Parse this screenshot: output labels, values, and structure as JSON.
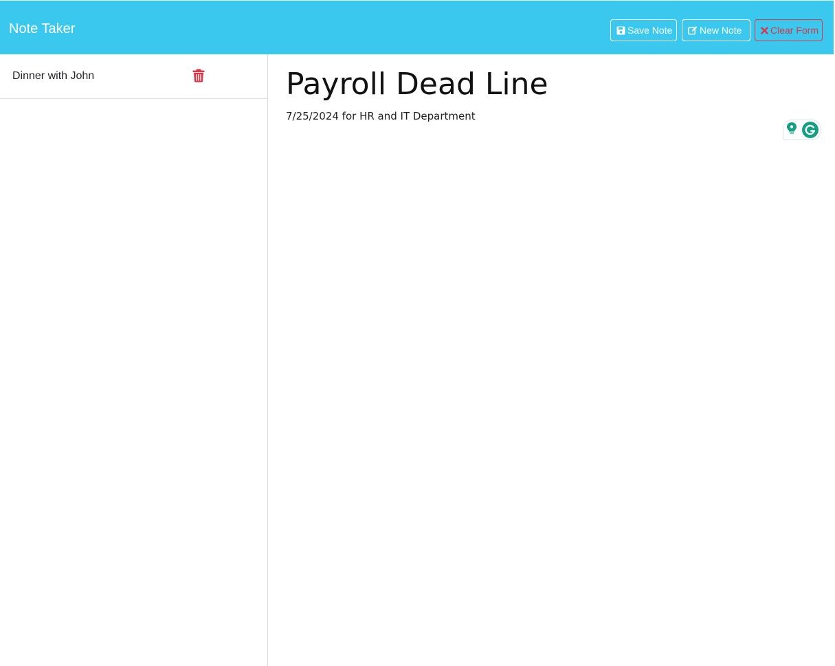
{
  "navbar": {
    "title": "Note Taker",
    "buttons": {
      "save": "Save Note",
      "new": "New Note",
      "clear": "Clear Form"
    }
  },
  "sidebar": {
    "notes": [
      {
        "title": "Dinner with John"
      }
    ]
  },
  "editor": {
    "title_value": "Payroll Dead Line",
    "body_value": "7/25/2024 for HR and IT Department"
  },
  "colors": {
    "navbar": "#3ac8ef",
    "danger": "#dc3545",
    "grammarly": "#15a084"
  },
  "icons": {
    "save": "floppy-disk-icon",
    "new": "edit-icon",
    "clear": "close-icon",
    "delete": "trash-icon",
    "assistant": "grammarly-icon"
  }
}
